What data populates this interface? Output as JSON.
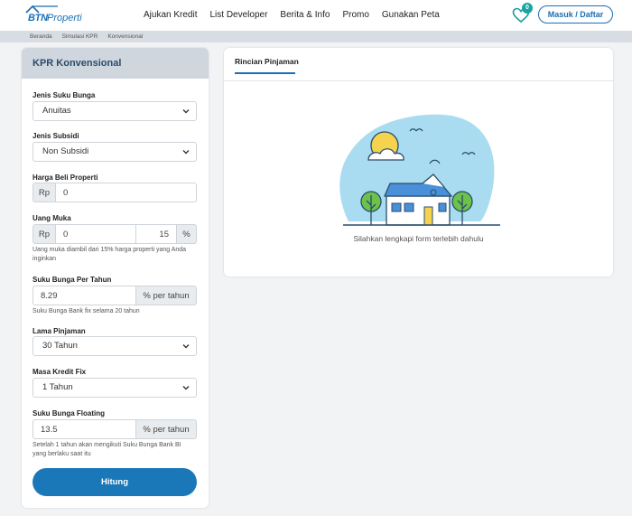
{
  "header": {
    "logo_brand": "BTN",
    "logo_suffix": "Properti",
    "nav": [
      "Ajukan Kredit",
      "List Developer",
      "Berita & Info",
      "Promo",
      "Gunakan Peta"
    ],
    "wishlist_count": "0",
    "login_label": "Masuk / Daftar",
    "accent_color": "#1a6fb5"
  },
  "breadcrumb": [
    "Beranda",
    "Simulasi KPR",
    "Konvensional"
  ],
  "form": {
    "title": "KPR Konvensional",
    "jenis_suku_bunga": {
      "label": "Jenis Suku Bunga",
      "value": "Anuitas"
    },
    "jenis_subsidi": {
      "label": "Jenis Subsidi",
      "value": "Non Subsidi"
    },
    "harga_beli": {
      "label": "Harga Beli Properti",
      "prefix": "Rp",
      "value": "0"
    },
    "uang_muka": {
      "label": "Uang Muka",
      "prefix": "Rp",
      "value": "0",
      "percent": "15",
      "suffix": "%",
      "help": "Uang muka diambil dari 15% harga properti yang Anda inginkan"
    },
    "suku_bunga": {
      "label": "Suku Bunga Per Tahun",
      "value": "8.29",
      "suffix": "% per tahun",
      "help": "Suku Bunga Bank fix selama 20 tahun"
    },
    "lama_pinjaman": {
      "label": "Lama Pinjaman",
      "value": "30 Tahun"
    },
    "masa_kredit_fix": {
      "label": "Masa Kredit Fix",
      "value": "1 Tahun"
    },
    "suku_bunga_floating": {
      "label": "Suku Bunga Floating",
      "value": "13.5",
      "suffix": "% per tahun",
      "help": "Setelah 1 tahun akan mengikuti Suku Bunga Bank BI yang berlaku saat itu"
    },
    "submit_label": "Hitung"
  },
  "result": {
    "tab_label": "Rincian Pinjaman",
    "empty_message": "Silahkan lengkapi form terlebih dahulu",
    "illustration_icon": "house-illustration"
  }
}
